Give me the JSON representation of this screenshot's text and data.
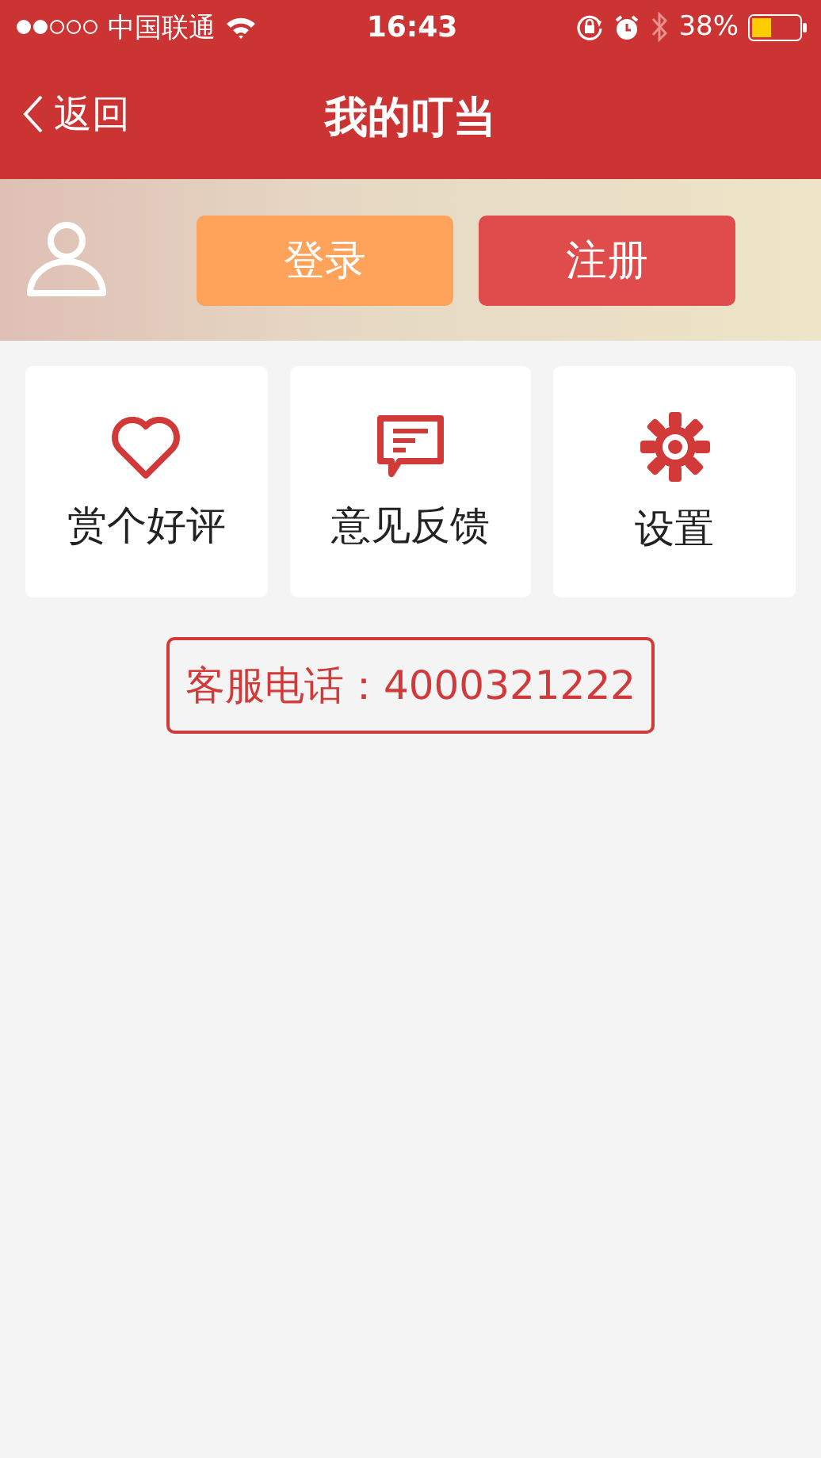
{
  "status_bar": {
    "carrier": "中国联通",
    "time": "16:43",
    "battery": "38%"
  },
  "nav": {
    "back": "返回",
    "title": "我的叮当"
  },
  "account": {
    "login": "登录",
    "register": "注册"
  },
  "tiles": [
    {
      "kind": "heart",
      "label": "赏个好评"
    },
    {
      "kind": "message",
      "label": "意见反馈"
    },
    {
      "kind": "gear",
      "label": "设置"
    }
  ],
  "hotline": "客服电话：4000321222"
}
